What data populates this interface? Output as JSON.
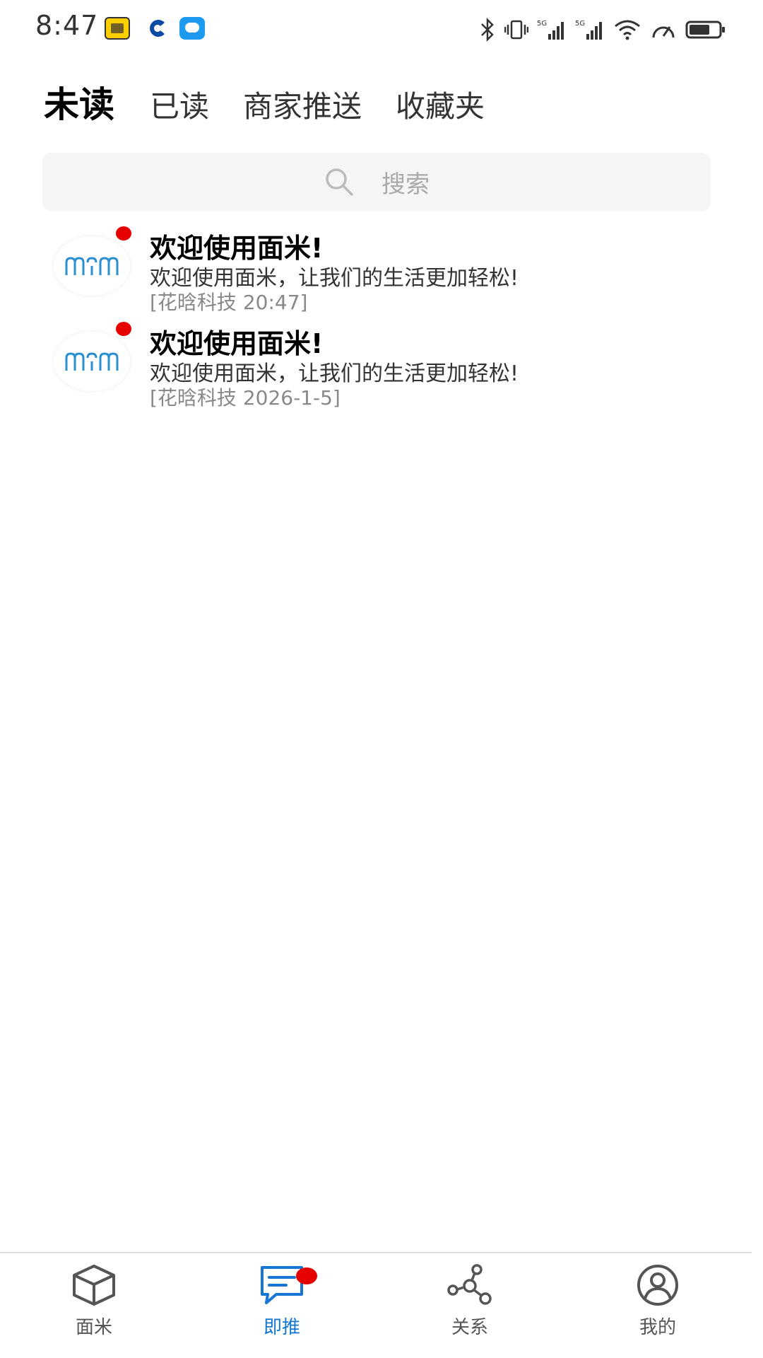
{
  "status_bar": {
    "time": "8:47",
    "icons": [
      "meituan-icon",
      "bank-icon",
      "message-app-icon",
      "bluetooth-icon",
      "vibrate-icon",
      "signal-5g-icon",
      "signal-5g-icon",
      "wifi-icon",
      "speed-icon",
      "battery-icon"
    ],
    "battery_level": 0.7
  },
  "tabs": [
    {
      "label": "未读",
      "active": true
    },
    {
      "label": "已读",
      "active": false
    },
    {
      "label": "商家推送",
      "active": false
    },
    {
      "label": "收藏夹",
      "active": false
    }
  ],
  "search": {
    "placeholder": "搜索"
  },
  "messages": [
    {
      "title": "欢迎使用面米!",
      "body": "欢迎使用面米，让我们的生活更加轻松!",
      "meta": "[花晗科技 20:47]",
      "unread": true
    },
    {
      "title": "欢迎使用面米!",
      "body": "欢迎使用面米，让我们的生活更加轻松!",
      "meta": "[花晗科技 2026-1-5]",
      "unread": true
    }
  ],
  "bottom_nav": [
    {
      "label": "面米",
      "icon": "cube-icon",
      "active": false
    },
    {
      "label": "即推",
      "icon": "chat-icon",
      "active": true,
      "badge": true
    },
    {
      "label": "关系",
      "icon": "network-icon",
      "active": false
    },
    {
      "label": "我的",
      "icon": "user-icon",
      "active": false
    }
  ],
  "colors": {
    "accent": "#1677d2",
    "badge": "#e60000",
    "logo": "#2a8fd0"
  }
}
